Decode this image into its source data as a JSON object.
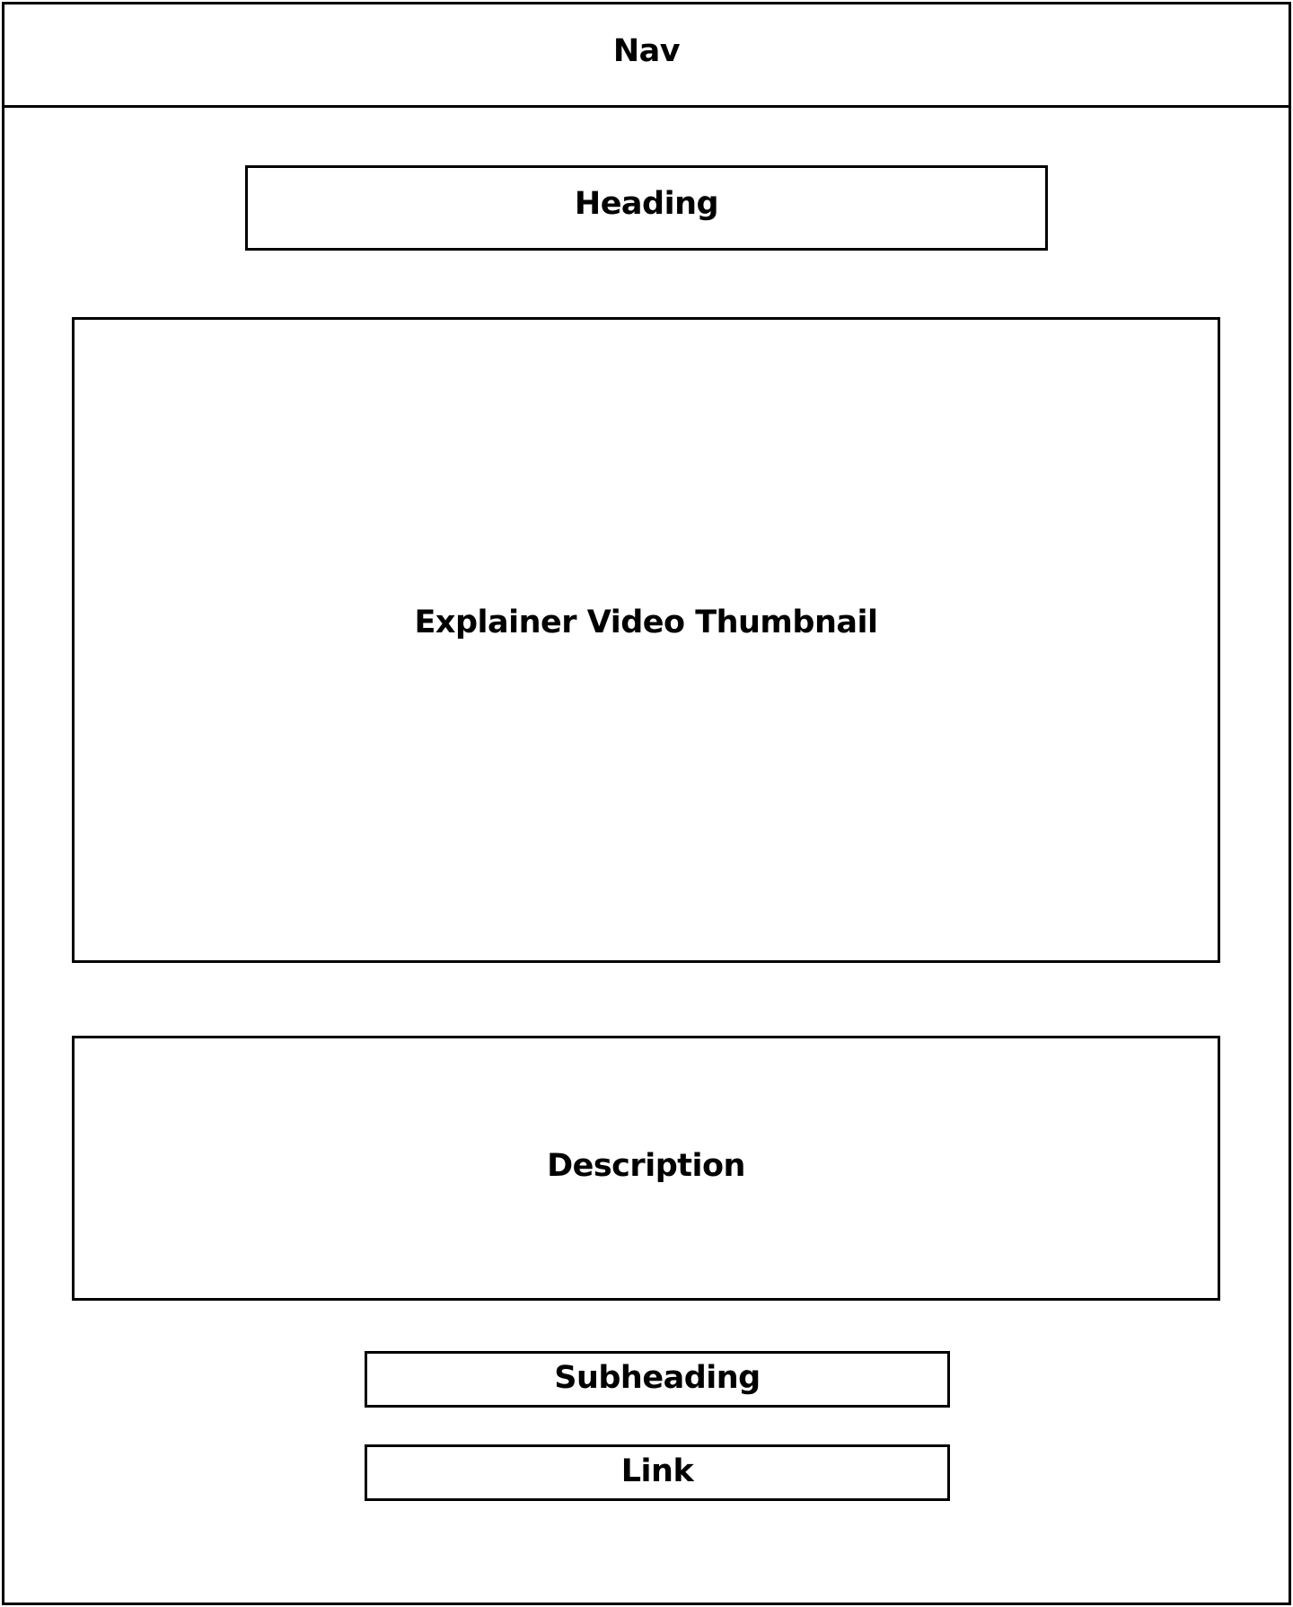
{
  "nav": {
    "label": "Nav"
  },
  "heading": {
    "label": "Heading"
  },
  "thumbnail": {
    "label": "Explainer Video Thumbnail"
  },
  "description": {
    "label": "Description"
  },
  "subheading": {
    "label": "Subheading"
  },
  "link": {
    "label": "Link"
  },
  "colors": {
    "stroke": "#000000",
    "background": "#ffffff"
  }
}
